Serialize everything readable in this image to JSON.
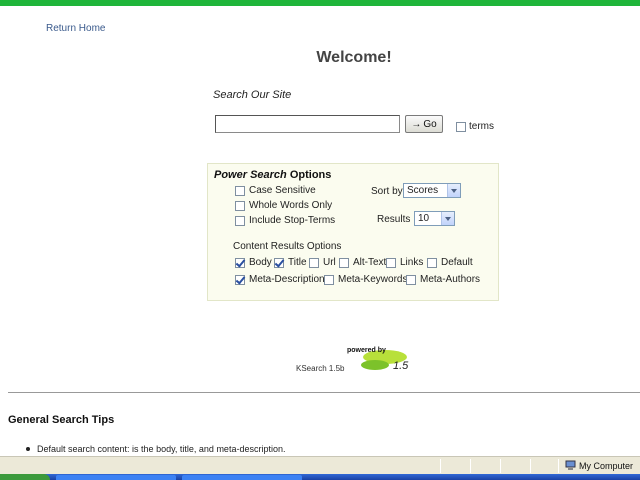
{
  "nav": {
    "return_home": "Return Home"
  },
  "page": {
    "welcome": "Welcome!"
  },
  "search": {
    "label": "Search Our Site",
    "value": "",
    "go_arrow": "→",
    "go_label": "Go",
    "terms_label": "terms",
    "terms_checked": false
  },
  "power": {
    "title_em": "Power Search",
    "title_rest": " Options",
    "options": [
      {
        "label": "Case Sensitive",
        "checked": false
      },
      {
        "label": "Whole Words Only",
        "checked": false
      },
      {
        "label": "Include Stop-Terms",
        "checked": false
      }
    ],
    "sort_label": "Sort by",
    "sort_value": "Scores",
    "results_label": "Results",
    "results_value": "10",
    "content_label": "Content Results Options",
    "content_options": [
      {
        "label": "Body",
        "checked": true
      },
      {
        "label": "Title",
        "checked": true
      },
      {
        "label": "Url",
        "checked": false
      },
      {
        "label": "Alt-Text",
        "checked": false
      },
      {
        "label": "Links",
        "checked": false
      },
      {
        "label": "Default",
        "checked": false
      },
      {
        "label": "Meta-Description",
        "checked": true
      },
      {
        "label": "Meta-Keywords",
        "checked": false
      },
      {
        "label": "Meta-Authors",
        "checked": false
      }
    ]
  },
  "footer": {
    "powered_by": "powered by",
    "logo_version": "1.5",
    "version": "KSearch 1.5b"
  },
  "tips": {
    "heading": "General Search Tips",
    "items": [
      "Default search content: is the body, title, and meta-description."
    ]
  },
  "status": {
    "zone": "My Computer"
  },
  "colors": {
    "accent_green": "#1fb53a",
    "panel_bg": "#fbfcef",
    "link": "#3a5a8c"
  }
}
